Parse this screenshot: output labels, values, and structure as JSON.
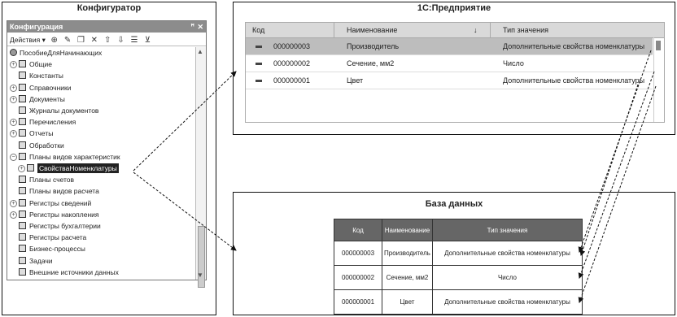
{
  "configurator": {
    "title": "Конфигуратор",
    "panel_title": "Конфигурация",
    "pin_glyph": "ꟸ",
    "close_glyph": "✕",
    "actions_label": "Действия ▾",
    "toolbar_icons": [
      "add-circle-icon",
      "edit-icon",
      "copy-icon",
      "delete-icon",
      "move-up-icon",
      "move-down-icon",
      "list-icon",
      "filter-icon"
    ],
    "tree": [
      {
        "label": "ПособиеДляНачинающих",
        "indent": 0,
        "expander": "",
        "icon": "root"
      },
      {
        "label": "Общие",
        "indent": 1,
        "expander": "+",
        "icon": "common"
      },
      {
        "label": "Константы",
        "indent": 1,
        "expander": "",
        "icon": "constants"
      },
      {
        "label": "Справочники",
        "indent": 1,
        "expander": "+",
        "icon": "catalogs"
      },
      {
        "label": "Документы",
        "indent": 1,
        "expander": "+",
        "icon": "documents"
      },
      {
        "label": "Журналы документов",
        "indent": 1,
        "expander": "",
        "icon": "journals"
      },
      {
        "label": "Перечисления",
        "indent": 1,
        "expander": "+",
        "icon": "enums"
      },
      {
        "label": "Отчеты",
        "indent": 1,
        "expander": "+",
        "icon": "reports"
      },
      {
        "label": "Обработки",
        "indent": 1,
        "expander": "",
        "icon": "processing"
      },
      {
        "label": "Планы видов характеристик",
        "indent": 1,
        "expander": "−",
        "icon": "pvh"
      },
      {
        "label": "СвойстваНоменклатуры",
        "indent": 2,
        "expander": "+",
        "icon": "pvh-item",
        "selected": true
      },
      {
        "label": "Планы счетов",
        "indent": 1,
        "expander": "",
        "icon": "accounts"
      },
      {
        "label": "Планы видов расчета",
        "indent": 1,
        "expander": "",
        "icon": "calc"
      },
      {
        "label": "Регистры сведений",
        "indent": 1,
        "expander": "+",
        "icon": "info-reg"
      },
      {
        "label": "Регистры накопления",
        "indent": 1,
        "expander": "+",
        "icon": "accum-reg"
      },
      {
        "label": "Регистры бухгалтерии",
        "indent": 1,
        "expander": "",
        "icon": "acc-reg"
      },
      {
        "label": "Регистры расчета",
        "indent": 1,
        "expander": "",
        "icon": "calc-reg"
      },
      {
        "label": "Бизнес-процессы",
        "indent": 1,
        "expander": "",
        "icon": "bp"
      },
      {
        "label": "Задачи",
        "indent": 1,
        "expander": "",
        "icon": "tasks"
      },
      {
        "label": "Внешние источники данных",
        "indent": 1,
        "expander": "",
        "icon": "ext"
      }
    ]
  },
  "enterprise": {
    "title": "1С:Предприятие",
    "columns": [
      "Код",
      "Наименование",
      "Тип значения"
    ],
    "sort_glyph": "↓",
    "rows": [
      {
        "code": "000000003",
        "name": "Производитель",
        "type": "Дополнительные свойства номенклатуры",
        "selected": true
      },
      {
        "code": "000000002",
        "name": "Сечение, мм2",
        "type": "Число"
      },
      {
        "code": "000000001",
        "name": "Цвет",
        "type": "Дополнительные свойства номенклатуры"
      }
    ]
  },
  "database": {
    "title": "База данных",
    "columns": [
      "Код",
      "Наименование",
      "Тип значения"
    ],
    "rows": [
      {
        "code": "000000003",
        "name": "Производитель",
        "type": "Дополнительные свойства номенклатуры"
      },
      {
        "code": "000000002",
        "name": "Сечение, мм2",
        "type": "Число"
      },
      {
        "code": "000000001",
        "name": "Цвет",
        "type": "Дополнительные свойства номенклатуры"
      }
    ]
  }
}
